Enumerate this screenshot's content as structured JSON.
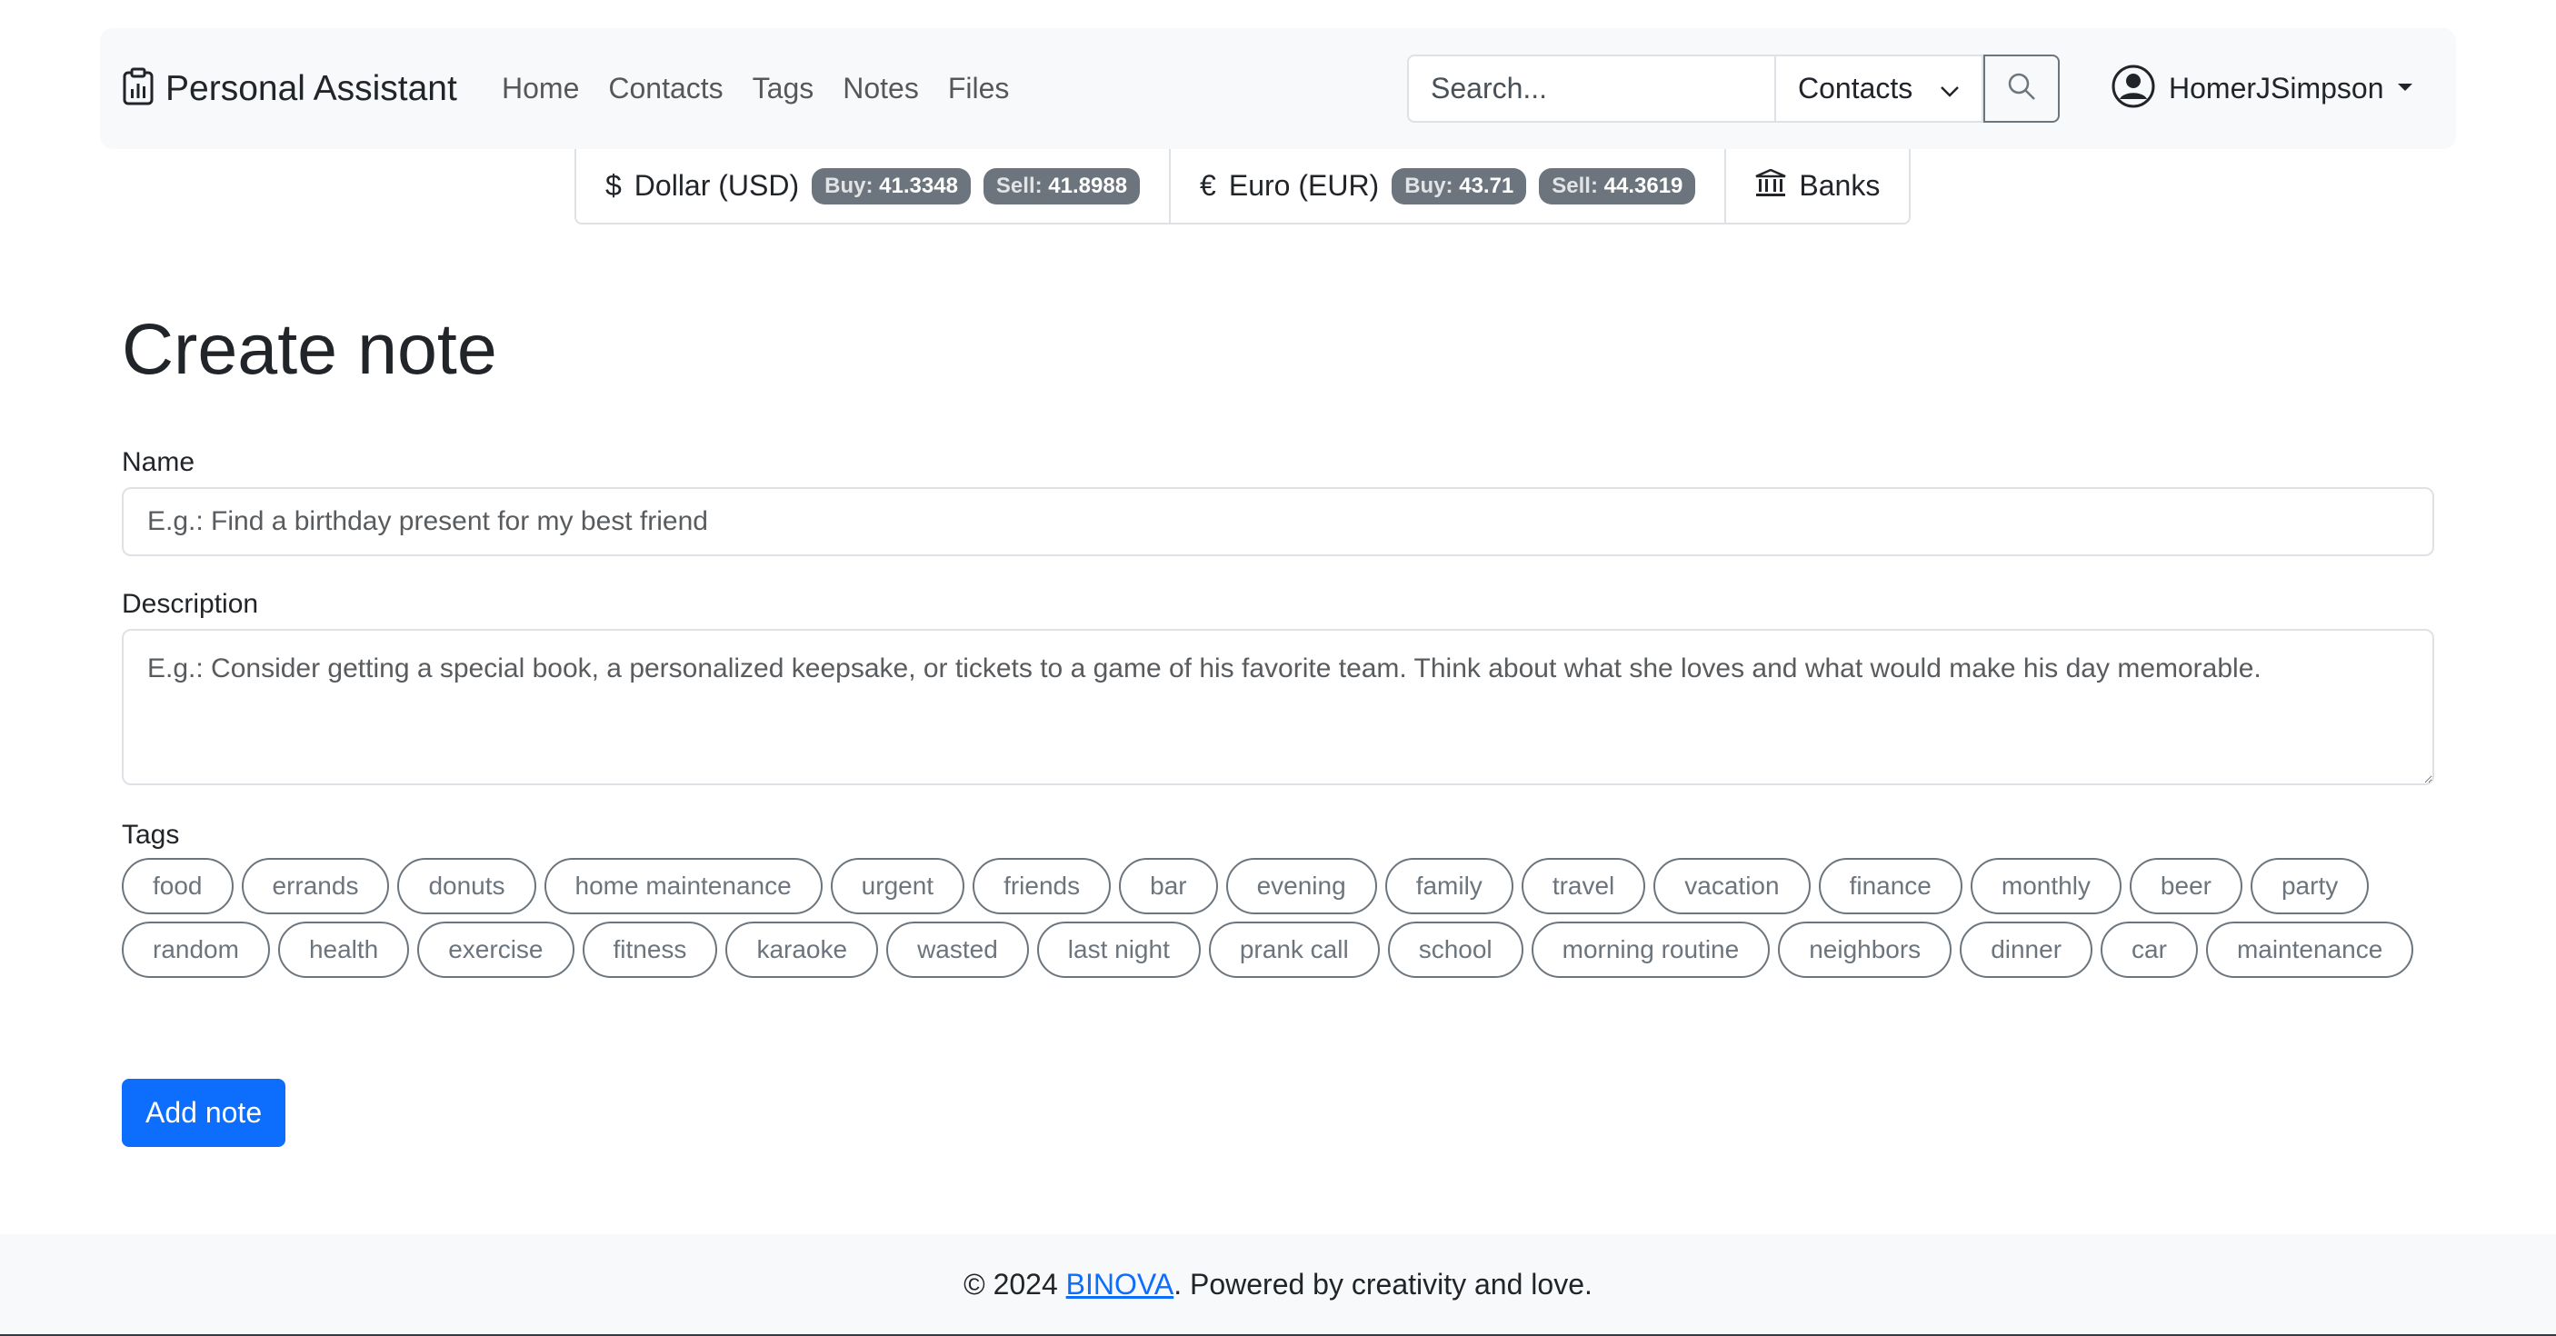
{
  "brand": {
    "title": "Personal Assistant",
    "icon": "clipboard-data-icon"
  },
  "nav": {
    "items": [
      "Home",
      "Contacts",
      "Tags",
      "Notes",
      "Files"
    ]
  },
  "search": {
    "placeholder": "Search...",
    "scope": "Contacts",
    "button_icon": "search-icon"
  },
  "user": {
    "name": "HomerJSimpson",
    "icon": "person-circle-icon"
  },
  "rates": {
    "usd": {
      "symbol": "$",
      "label": "Dollar (USD)",
      "buy_label": "Buy:",
      "buy": "41.3348",
      "sell_label": "Sell:",
      "sell": "41.8988"
    },
    "eur": {
      "symbol": "€",
      "label": "Euro (EUR)",
      "buy_label": "Buy:",
      "buy": "43.71",
      "sell_label": "Sell:",
      "sell": "44.3619"
    },
    "banks": {
      "label": "Banks",
      "icon": "bank-icon"
    }
  },
  "form": {
    "title": "Create note",
    "name_label": "Name",
    "name_placeholder": "E.g.: Find a birthday present for my best friend",
    "description_label": "Description",
    "description_placeholder": "E.g.: Consider getting a special book, a personalized keepsake, or tickets to a game of his favorite team. Think about what she loves and what would make his day memorable.",
    "tags_label": "Tags",
    "tags": [
      "food",
      "errands",
      "donuts",
      "home maintenance",
      "urgent",
      "friends",
      "bar",
      "evening",
      "family",
      "travel",
      "vacation",
      "finance",
      "monthly",
      "beer",
      "party",
      "random",
      "health",
      "exercise",
      "fitness",
      "karaoke",
      "wasted",
      "last night",
      "prank call",
      "school",
      "morning routine",
      "neighbors",
      "dinner",
      "car",
      "maintenance"
    ],
    "submit_label": "Add note"
  },
  "footer": {
    "prefix": "© 2024 ",
    "link": "BINOVA",
    "suffix": ". Powered by creativity and love."
  },
  "colors": {
    "primary": "#0d6efd",
    "secondary": "#6c757d",
    "navbar_bg": "#f8f9fa"
  }
}
